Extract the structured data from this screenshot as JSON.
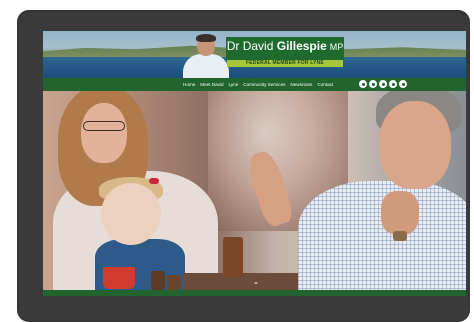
{
  "header": {
    "title_first": "Dr David",
    "title_last": "Gillespie",
    "title_suffix": "MP",
    "subtitle": "FEDERAL MEMBER FOR LYNE"
  },
  "nav": {
    "items": [
      {
        "label": "Home"
      },
      {
        "label": "Meet David"
      },
      {
        "label": "Lyne"
      },
      {
        "label": "Community Services"
      },
      {
        "label": "Newsroom"
      },
      {
        "label": "Contact"
      }
    ]
  },
  "socials": [
    {
      "icon": "facebook-icon"
    },
    {
      "icon": "twitter-icon"
    },
    {
      "icon": "youtube-icon"
    },
    {
      "icon": "instagram-icon"
    },
    {
      "icon": "email-icon"
    }
  ],
  "colors": {
    "brand_green": "#21642e",
    "accent_lime": "#a6c63a",
    "device_frame": "#3a3a3a"
  },
  "scroll": {
    "down_arrow_glyph": "⌄"
  }
}
